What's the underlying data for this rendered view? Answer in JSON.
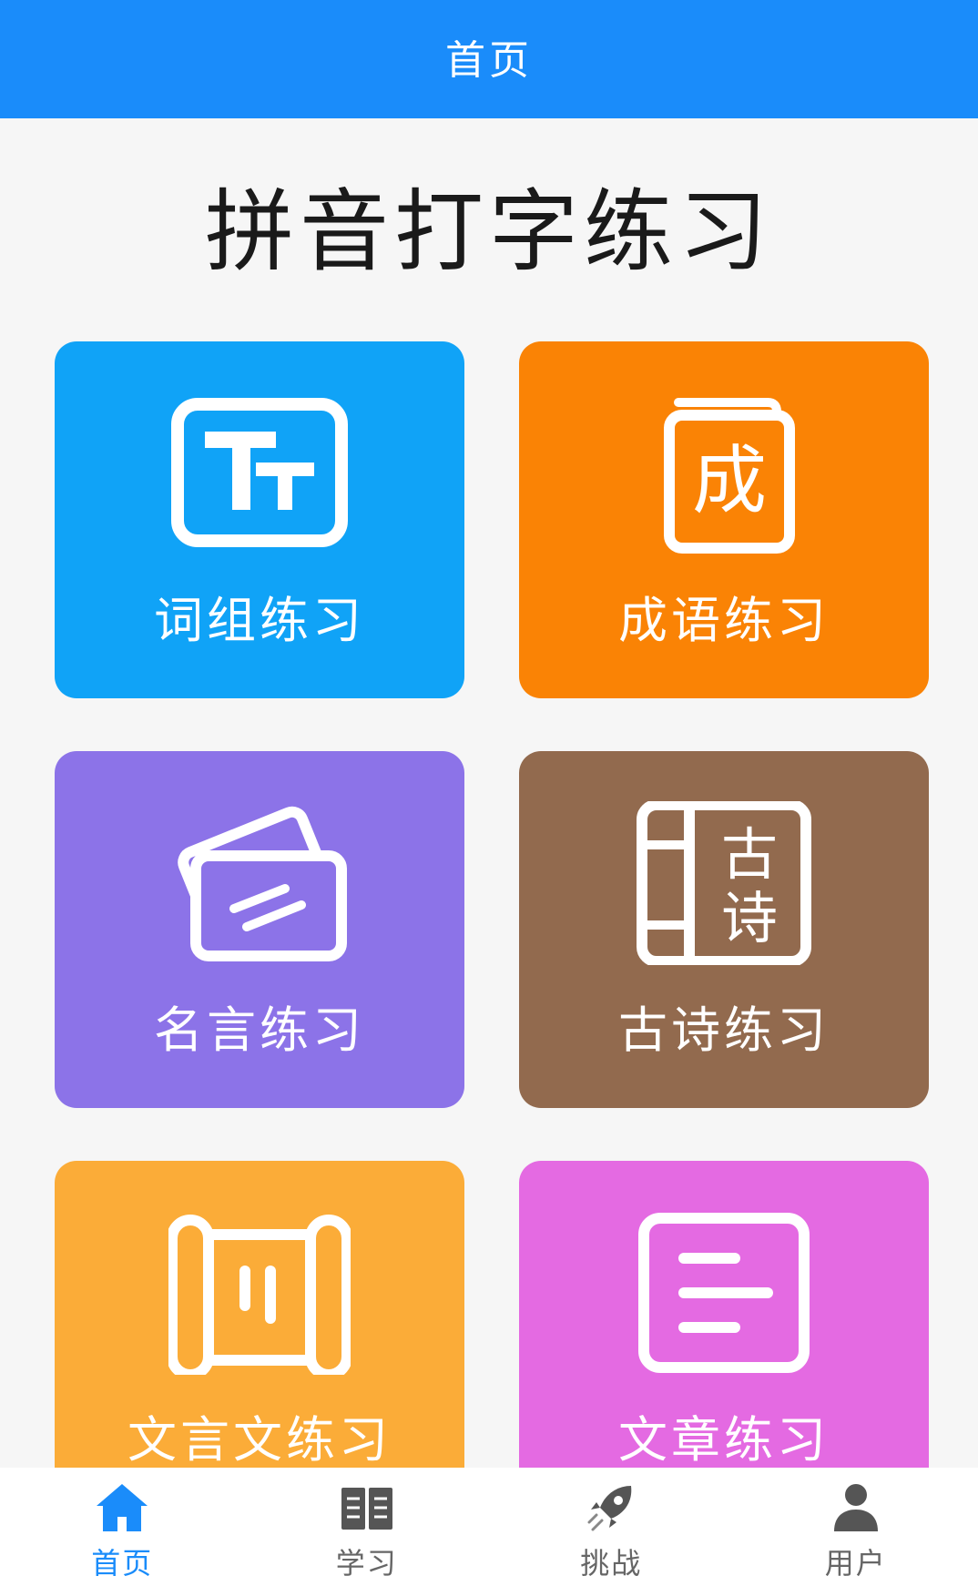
{
  "header": {
    "title": "首页"
  },
  "page": {
    "title": "拼音打字练习"
  },
  "tiles": [
    {
      "label": "词组练习",
      "color": "#10a3f7",
      "icon": "text-size-icon"
    },
    {
      "label": "成语练习",
      "color": "#fa8305",
      "icon": "idiom-book-icon"
    },
    {
      "label": "名言练习",
      "color": "#8c73e8",
      "icon": "cards-icon"
    },
    {
      "label": "古诗练习",
      "color": "#926a4e",
      "icon": "poem-book-icon"
    },
    {
      "label": "文言文练习",
      "color": "#fbac38",
      "icon": "scroll-icon"
    },
    {
      "label": "文章练习",
      "color": "#e46ae2",
      "icon": "document-icon"
    }
  ],
  "icon_glyphs": {
    "idiom": "成",
    "poem_top": "古",
    "poem_bottom": "诗"
  },
  "tabbar": {
    "items": [
      {
        "label": "首页",
        "icon": "home-icon",
        "active": true
      },
      {
        "label": "学习",
        "icon": "book-icon",
        "active": false
      },
      {
        "label": "挑战",
        "icon": "rocket-icon",
        "active": false
      },
      {
        "label": "用户",
        "icon": "user-icon",
        "active": false
      }
    ],
    "active_color": "#1a8cfa",
    "inactive_color": "#666666"
  }
}
